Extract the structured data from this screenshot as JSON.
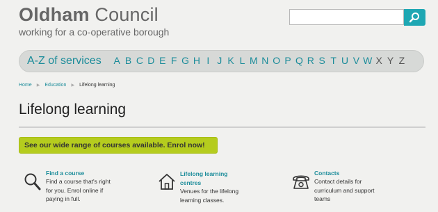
{
  "header": {
    "logo_bold": "Oldham",
    "logo_rest": " Council",
    "tagline": "working for a co-operative borough",
    "search": {
      "placeholder": "",
      "button_icon": "search-icon"
    }
  },
  "az": {
    "title": "A-Z of services",
    "letters": [
      "A",
      "B",
      "C",
      "D",
      "E",
      "F",
      "G",
      "H",
      "I",
      "J",
      "K",
      "L",
      "M",
      "N",
      "O",
      "P",
      "Q",
      "R",
      "S",
      "T",
      "U",
      "V",
      "W",
      "X",
      "Y",
      "Z"
    ]
  },
  "breadcrumb": {
    "home": "Home",
    "education": "Education",
    "current": "Lifelong learning"
  },
  "page": {
    "title": "Lifelong learning"
  },
  "cta": {
    "label": "See our wide range of courses available. Enrol now!"
  },
  "features": [
    {
      "title": "Find a course",
      "desc": "Find a course that's right for you. Enrol online if paying in full.",
      "icon": "magnifier-icon"
    },
    {
      "title": "Lifelong learning centres",
      "desc": "Venues for the lifelong learning classes.",
      "icon": "house-icon"
    },
    {
      "title": "Contacts",
      "desc": "Contact details for curriculum and support teams",
      "icon": "telephone-icon"
    }
  ],
  "colors": {
    "accent": "#1b8c9a",
    "cta": "#b5cc1e",
    "search_button": "#1ea7b3"
  }
}
